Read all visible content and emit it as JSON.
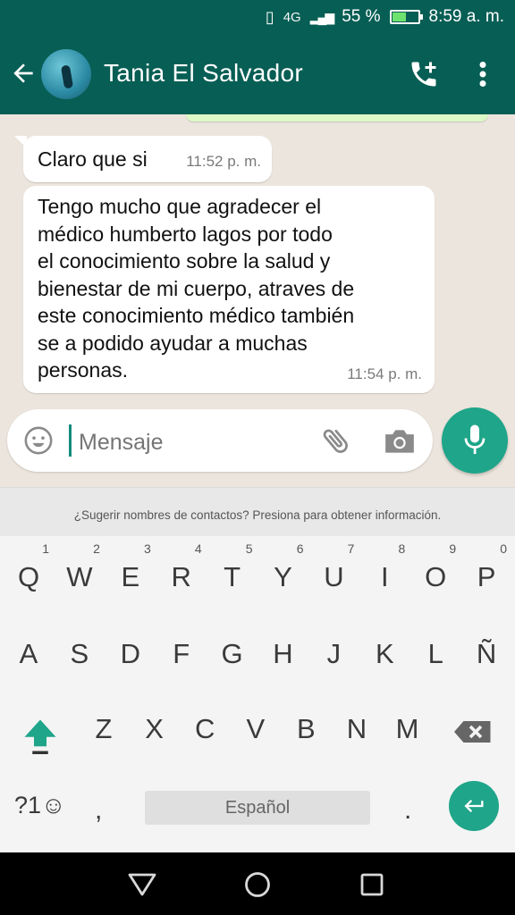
{
  "status_bar": {
    "network": "4G",
    "battery_percent": "55 %",
    "battery_level": 0.55,
    "time": "8:59 a. m."
  },
  "header": {
    "contact_name": "Tania El Salvador"
  },
  "messages": [
    {
      "text": "Claro que si",
      "time": "11:52 p. m."
    },
    {
      "text": "Tengo mucho que agradecer   el\nmédico humberto lagos por todo\nel conocimiento sobre la salud y\nbienestar de mi cuerpo, atraves de\neste conocimiento médico también\nse a podido ayudar a muchas\npersonas.",
      "time": "11:54 p. m."
    }
  ],
  "composer": {
    "placeholder": "Mensaje",
    "value": ""
  },
  "suggestion_bar": {
    "text": "¿Sugerir nombres de contactos? Presiona para obtener información."
  },
  "keyboard": {
    "row1": [
      {
        "k": "Q",
        "s": "1"
      },
      {
        "k": "W",
        "s": "2"
      },
      {
        "k": "E",
        "s": "3"
      },
      {
        "k": "R",
        "s": "4"
      },
      {
        "k": "T",
        "s": "5"
      },
      {
        "k": "Y",
        "s": "6"
      },
      {
        "k": "U",
        "s": "7"
      },
      {
        "k": "I",
        "s": "8"
      },
      {
        "k": "O",
        "s": "9"
      },
      {
        "k": "P",
        "s": "0"
      }
    ],
    "row2": [
      "A",
      "S",
      "D",
      "F",
      "G",
      "H",
      "J",
      "K",
      "L",
      "Ñ"
    ],
    "row3": [
      "Z",
      "X",
      "C",
      "V",
      "B",
      "N",
      "M"
    ],
    "symbols_label": "?1☺",
    "comma": ",",
    "space_label": "Español",
    "period": "."
  },
  "colors": {
    "primary": "#075e54",
    "accent": "#1fa589",
    "chat_bg": "#ece5dd",
    "bubble": "#ffffff",
    "outgoing_bubble": "#dcf8c6"
  }
}
